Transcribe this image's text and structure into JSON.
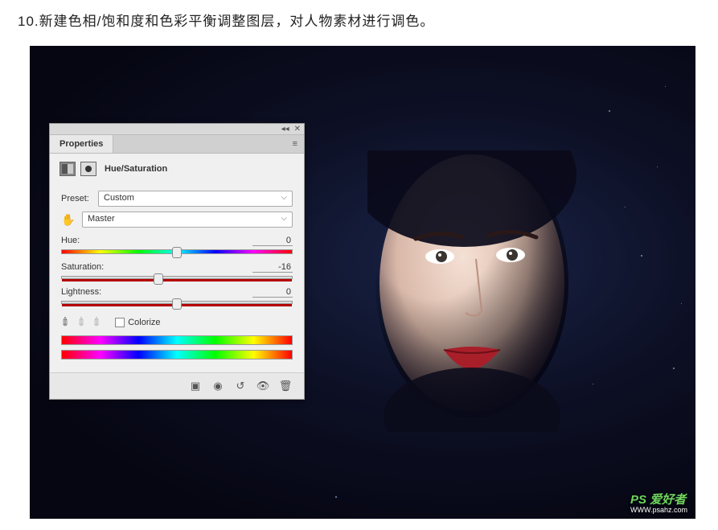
{
  "instruction": "10.新建色相/饱和度和色彩平衡调整图层，对人物素材进行调色。",
  "panel": {
    "tab": "Properties",
    "title": "Hue/Saturation",
    "preset_label": "Preset:",
    "preset_value": "Custom",
    "channel_value": "Master",
    "sliders": {
      "hue": {
        "label": "Hue:",
        "value": "0",
        "pos": 50
      },
      "saturation": {
        "label": "Saturation:",
        "value": "-16",
        "pos": 42
      },
      "lightness": {
        "label": "Lightness:",
        "value": "0",
        "pos": 50
      }
    },
    "colorize_label": "Colorize",
    "colorize_checked": false,
    "footer_icons": [
      "clip-icon",
      "view-prev-icon",
      "reset-icon",
      "visibility-icon",
      "delete-icon"
    ]
  },
  "watermark": {
    "text": "PS 爱好者",
    "url": "WWW.psahz.com"
  }
}
